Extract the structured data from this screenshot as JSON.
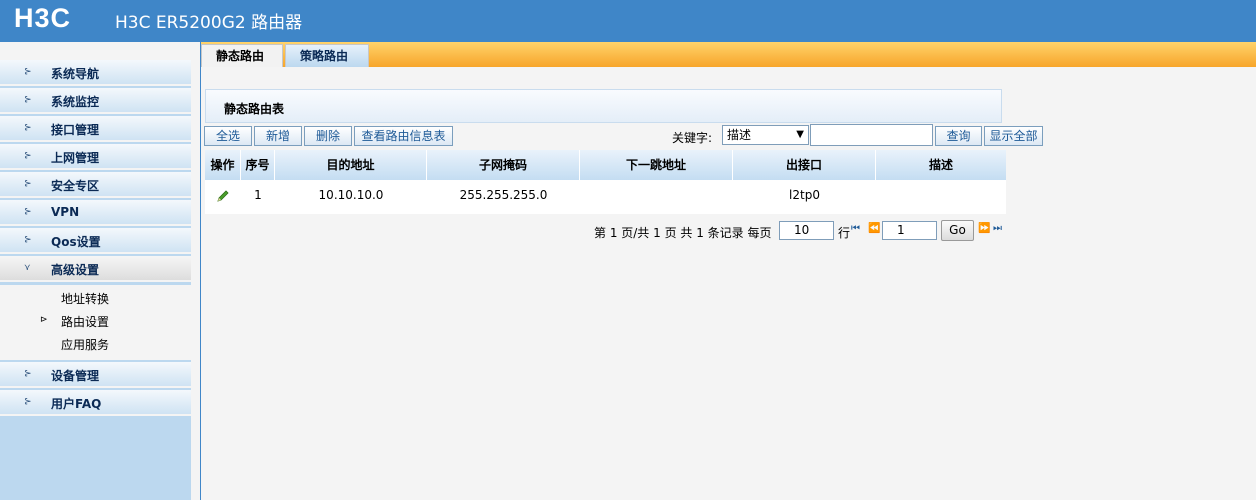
{
  "header": {
    "logo": "H3C",
    "title": "H3C ER5200G2 路由器"
  },
  "sidebar": {
    "items": [
      {
        "label": "系统导航"
      },
      {
        "label": "系统监控"
      },
      {
        "label": "接口管理"
      },
      {
        "label": "上网管理"
      },
      {
        "label": "安全专区"
      },
      {
        "label": "VPN"
      },
      {
        "label": "Qos设置"
      },
      {
        "label": "高级设置"
      },
      {
        "label": "设备管理"
      },
      {
        "label": "用户FAQ"
      }
    ],
    "submenu": [
      {
        "label": "地址转换"
      },
      {
        "label": "路由设置"
      },
      {
        "label": "应用服务"
      }
    ]
  },
  "tabs": [
    {
      "label": "静态路由"
    },
    {
      "label": "策略路由"
    }
  ],
  "panel": {
    "title": "静态路由表"
  },
  "toolbar": {
    "select_all": "全选",
    "add": "新增",
    "delete": "删除",
    "view_route_info": "查看路由信息表",
    "keyword_label": "关键字:",
    "keyword_selected": "描述",
    "keyword_value": "",
    "search": "查询",
    "show_all": "显示全部"
  },
  "table": {
    "headers": [
      "操作",
      "序号",
      "目的地址",
      "子网掩码",
      "下一跳地址",
      "出接口",
      "描述"
    ],
    "rows": [
      {
        "index": "1",
        "destination": "10.10.10.0",
        "mask": "255.255.255.0",
        "next_hop": "",
        "interface": "l2tp0",
        "description": ""
      }
    ]
  },
  "pager": {
    "summary": "第 1 页/共 1 页 共 1 条记录 每页",
    "per_page": "10",
    "per_page_suffix": "行",
    "page_input": "1",
    "go": "Go"
  }
}
